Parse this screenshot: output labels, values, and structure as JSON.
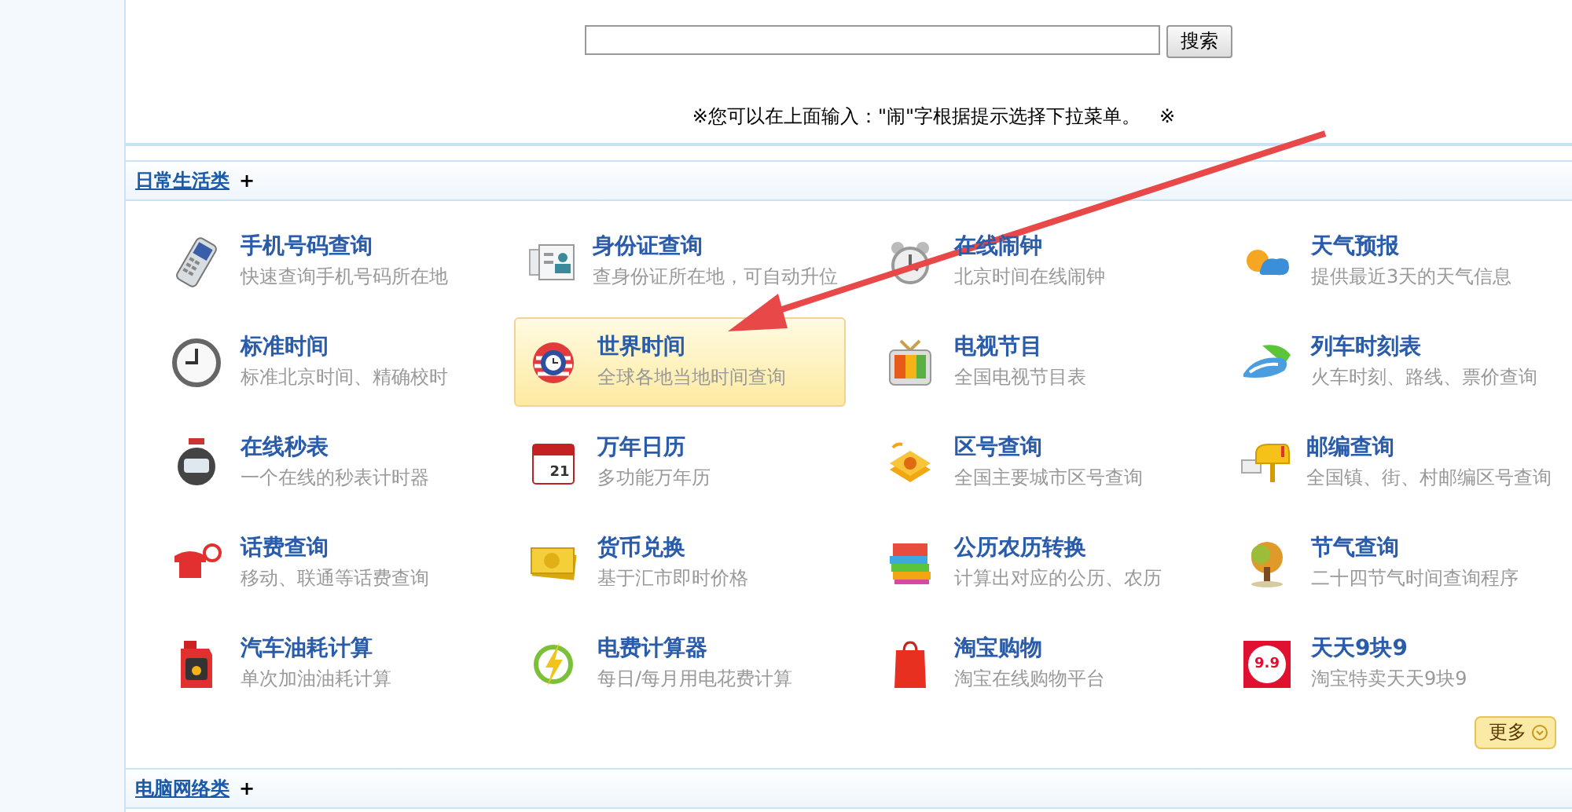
{
  "search": {
    "button": "搜索"
  },
  "note": "※您可以在上面输入：\"闹\"字根据提示选择下拉菜单。　※",
  "sections": [
    {
      "title": "日常生活类",
      "expand": "+",
      "more": "更多",
      "items": [
        {
          "title": "手机号码查询",
          "desc": "快速查询手机号码所在地",
          "selected": false
        },
        {
          "title": "身份证查询",
          "desc": "查身份证所在地，可自动升位",
          "selected": false
        },
        {
          "title": "在线闹钟",
          "desc": "北京时间在线闹钟",
          "selected": false
        },
        {
          "title": "天气预报",
          "desc": "提供最近3天的天气信息",
          "selected": false
        },
        {
          "title": "标准时间",
          "desc": "标准北京时间、精确校时",
          "selected": false
        },
        {
          "title": "世界时间",
          "desc": "全球各地当地时间查询",
          "selected": true
        },
        {
          "title": "电视节目",
          "desc": "全国电视节目表",
          "selected": false
        },
        {
          "title": "列车时刻表",
          "desc": "火车时刻、路线、票价查询",
          "selected": false
        },
        {
          "title": "在线秒表",
          "desc": "一个在线的秒表计时器",
          "selected": false
        },
        {
          "title": "万年日历",
          "desc": "多功能万年历",
          "badge": "21",
          "selected": false
        },
        {
          "title": "区号查询",
          "desc": "全国主要城市区号查询",
          "selected": false
        },
        {
          "title": "邮编查询",
          "desc": "全国镇、街、村邮编区号查询",
          "selected": false
        },
        {
          "title": "话费查询",
          "desc": "移动、联通等话费查询",
          "selected": false
        },
        {
          "title": "货币兑换",
          "desc": "基于汇市即时价格",
          "selected": false
        },
        {
          "title": "公历农历转换",
          "desc": "计算出对应的公历、农历",
          "selected": false
        },
        {
          "title": "节气查询",
          "desc": "二十四节气时间查询程序",
          "selected": false
        },
        {
          "title": "汽车油耗计算",
          "desc": "单次加油油耗计算",
          "selected": false
        },
        {
          "title": "电费计算器",
          "desc": "每日/每月用电花费计算",
          "selected": false
        },
        {
          "title": "淘宝购物",
          "desc": "淘宝在线购物平台",
          "selected": false
        },
        {
          "title": "天天9块9",
          "desc": "淘宝特卖天天9块9",
          "badge": "9.9",
          "selected": false
        }
      ]
    },
    {
      "title": "电脑网络类",
      "expand": "+"
    }
  ]
}
